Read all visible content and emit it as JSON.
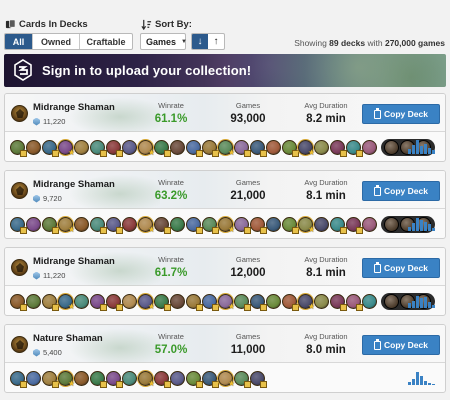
{
  "filters": {
    "cards_in_decks": {
      "label": "Cards In Decks",
      "options": [
        "All",
        "Owned",
        "Craftable"
      ],
      "active": "All"
    },
    "sort_by": {
      "label": "Sort By:",
      "selected": "Games",
      "dir_desc": "↓",
      "dir_asc": "↑"
    },
    "showing": {
      "prefix": "Showing",
      "decks": "89 decks",
      "mid": "with",
      "games": "270,000 games"
    }
  },
  "banner": {
    "text": "Sign in to upload your collection!"
  },
  "deck_labels": {
    "winrate": "Winrate",
    "games": "Games",
    "avg_duration": "Avg Duration",
    "copy": "Copy Deck"
  },
  "decks": [
    {
      "name": "Midrange Shaman",
      "dust": "11,220",
      "winrate": "61.1%",
      "games": "93,000",
      "duration": "8.2 min"
    },
    {
      "name": "Midrange Shaman",
      "dust": "9,720",
      "winrate": "63.2%",
      "games": "21,000",
      "duration": "8.1 min"
    },
    {
      "name": "Midrange Shaman",
      "dust": "11,220",
      "winrate": "61.7%",
      "games": "12,000",
      "duration": "8.1 min"
    },
    {
      "name": "Nature Shaman",
      "dust": "5,400",
      "winrate": "57.0%",
      "games": "11,000",
      "duration": "8.0 min"
    }
  ],
  "colors": {
    "accent": "#2c5a8c",
    "copy_button": "#3a82c4",
    "winrate_green": "#3a9a2a"
  },
  "icons": {
    "cards_in_decks": "cards-icon",
    "sort_by": "sort-icon",
    "banner": "hsreplay-logo-icon",
    "copy": "clipboard-icon",
    "dust": "dust-icon",
    "hero": "shaman-hero-icon"
  }
}
